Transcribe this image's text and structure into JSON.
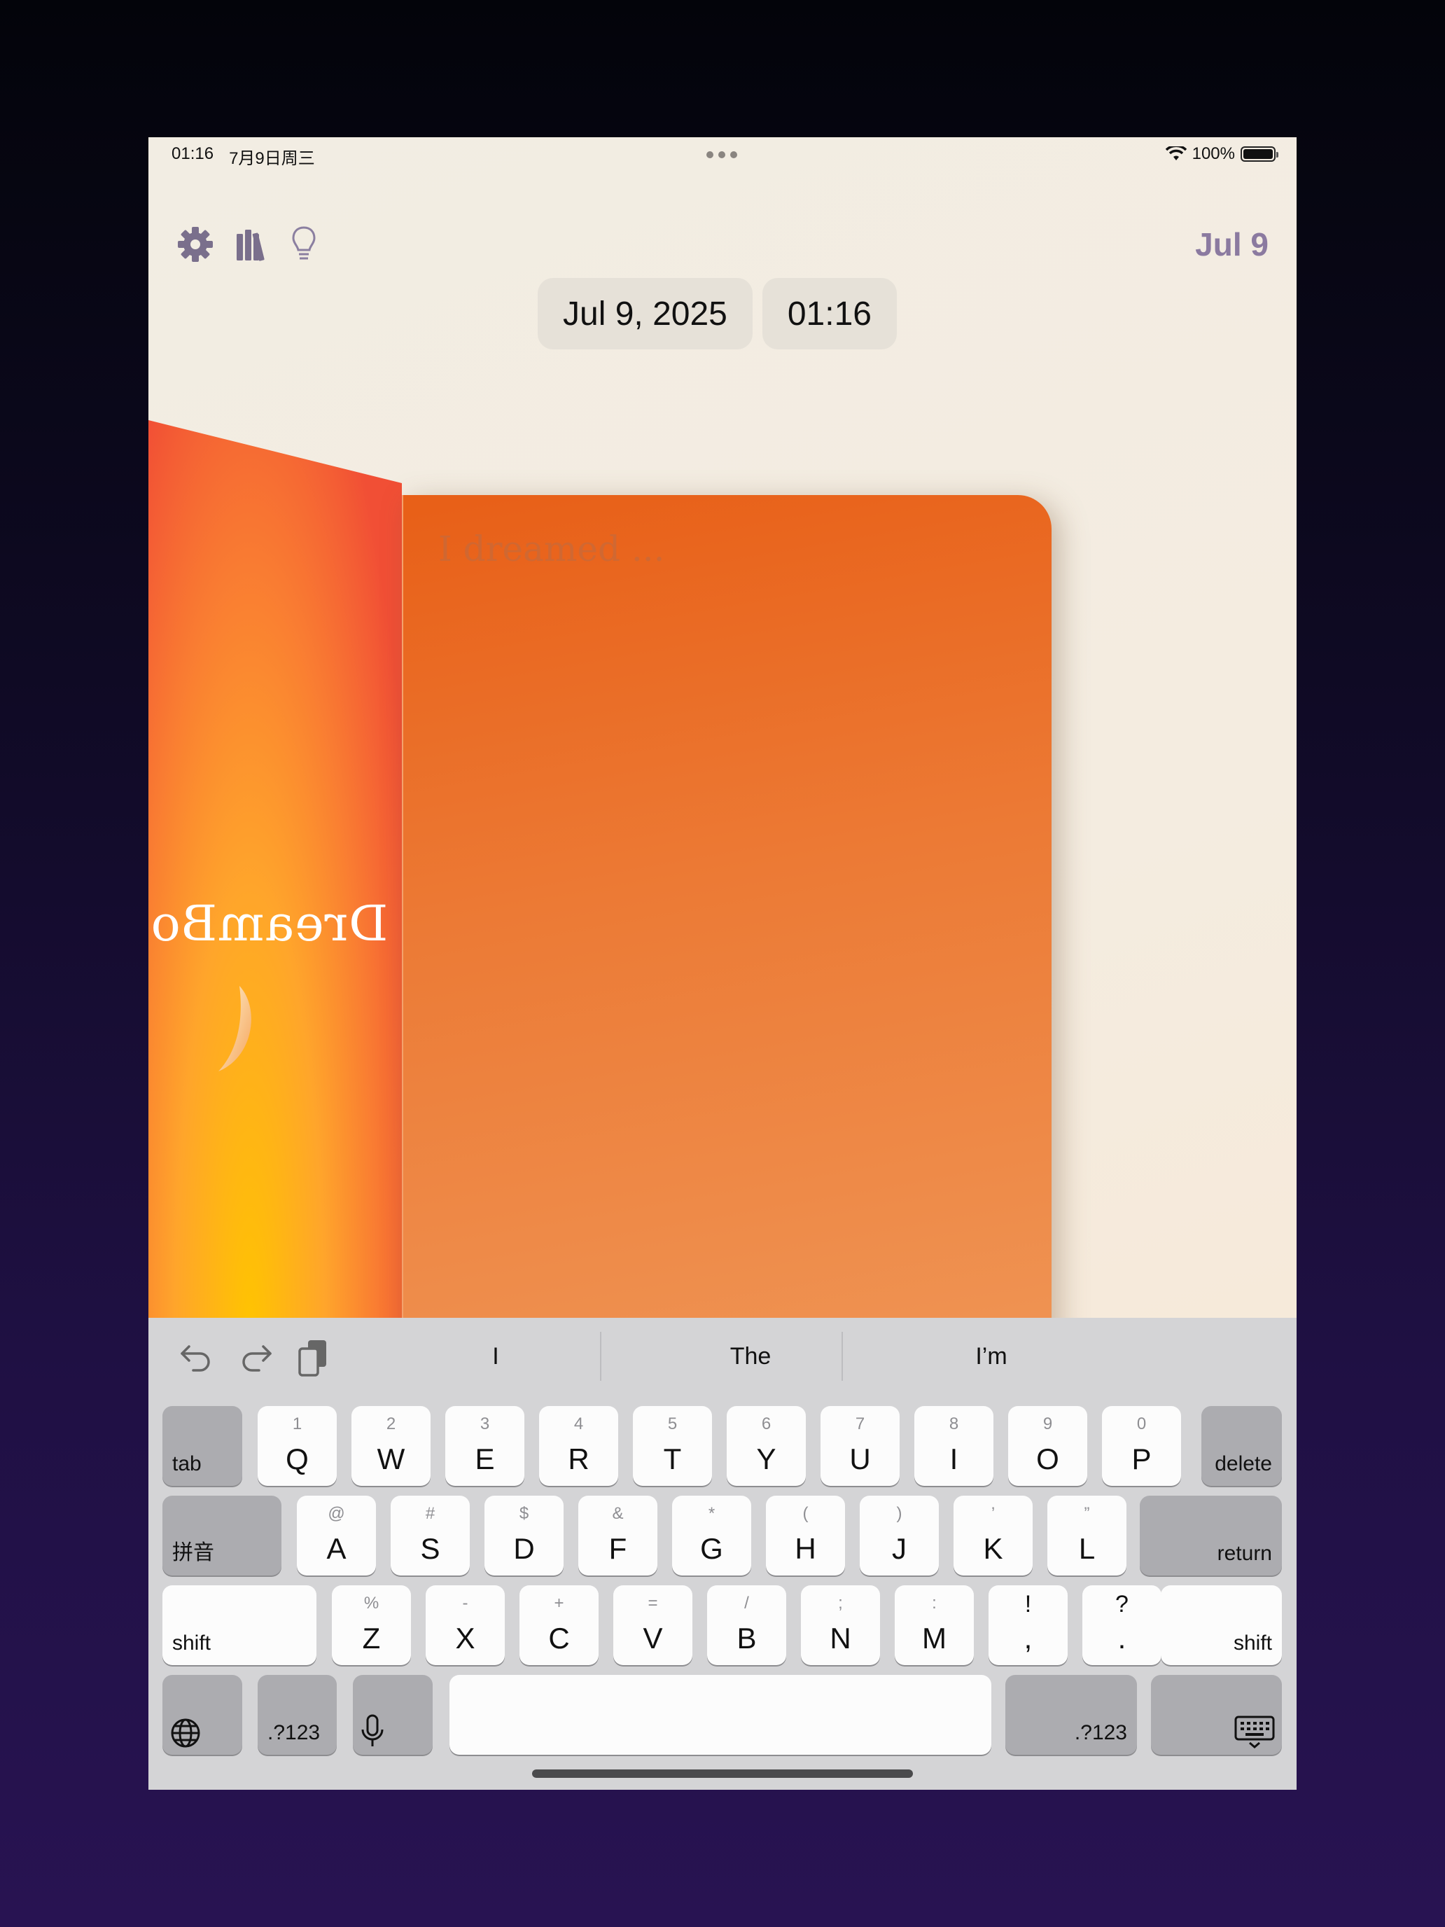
{
  "status_bar": {
    "time": "01:16",
    "date": "7月9日周三",
    "battery": "100%"
  },
  "toolbar": {
    "icons": [
      "gear-icon",
      "library-icon",
      "lightbulb-icon"
    ],
    "date_short": "Jul 9"
  },
  "date_picker": {
    "date": "Jul 9, 2025",
    "time": "01:16"
  },
  "journal": {
    "cover_title": "DreamBook",
    "placeholder": "I dreamed ...",
    "colors": {
      "page_top": "#e85f17",
      "page_bottom": "#f09a5b",
      "cover_accent": "#ffc400"
    }
  },
  "keyboard": {
    "suggestions": [
      "I",
      "The",
      "I’m"
    ],
    "row1": [
      {
        "k": "Q",
        "s": "1"
      },
      {
        "k": "W",
        "s": "2"
      },
      {
        "k": "E",
        "s": "3"
      },
      {
        "k": "R",
        "s": "4"
      },
      {
        "k": "T",
        "s": "5"
      },
      {
        "k": "Y",
        "s": "6"
      },
      {
        "k": "U",
        "s": "7"
      },
      {
        "k": "I",
        "s": "8"
      },
      {
        "k": "O",
        "s": "9"
      },
      {
        "k": "P",
        "s": "0"
      }
    ],
    "row2": [
      {
        "k": "A",
        "s": "@"
      },
      {
        "k": "S",
        "s": "#"
      },
      {
        "k": "D",
        "s": "$"
      },
      {
        "k": "F",
        "s": "&"
      },
      {
        "k": "G",
        "s": "*"
      },
      {
        "k": "H",
        "s": "("
      },
      {
        "k": "J",
        "s": ")"
      },
      {
        "k": "K",
        "s": "’"
      },
      {
        "k": "L",
        "s": "”"
      }
    ],
    "row3": [
      {
        "k": "Z",
        "s": "%"
      },
      {
        "k": "X",
        "s": "-"
      },
      {
        "k": "C",
        "s": "+"
      },
      {
        "k": "V",
        "s": "="
      },
      {
        "k": "B",
        "s": "/"
      },
      {
        "k": "N",
        "s": ";"
      },
      {
        "k": "M",
        "s": ":"
      },
      {
        "k": ",",
        "s": "!"
      },
      {
        "k": ".",
        "s": "?"
      }
    ],
    "tab": "tab",
    "delete": "delete",
    "pinyin": "拼音",
    "return": "return",
    "shift": "shift",
    "numbers": ".?123"
  }
}
